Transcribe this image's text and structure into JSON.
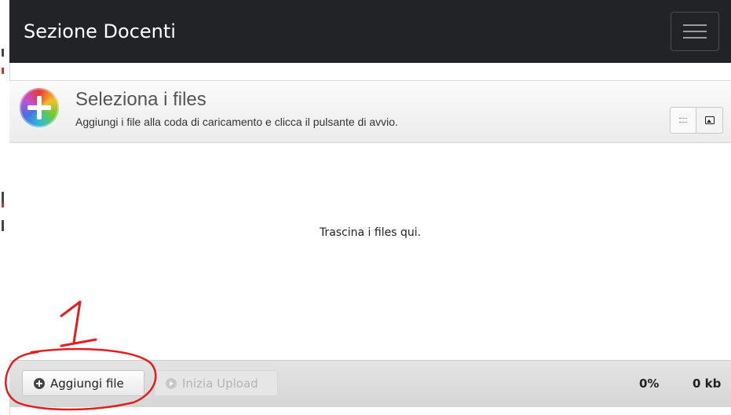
{
  "navbar": {
    "title": "Sezione Docenti",
    "menu_icon": "hamburger-icon"
  },
  "uploader": {
    "title": "Seleziona i files",
    "subtitle": "Aggiungi i file alla coda di caricamento e clicca il pulsante di avvio.",
    "header_icon": "add-circle-icon",
    "view_icons": [
      "list-view-icon",
      "thumbnail-view-icon"
    ],
    "drop_text": "Trascina i files qui."
  },
  "footer": {
    "add_label": "Aggiungi file",
    "start_label": "Inizia Upload",
    "percent": "0%",
    "size": "0 kb"
  },
  "annotation": {
    "number": "1",
    "color": "#e02020"
  }
}
